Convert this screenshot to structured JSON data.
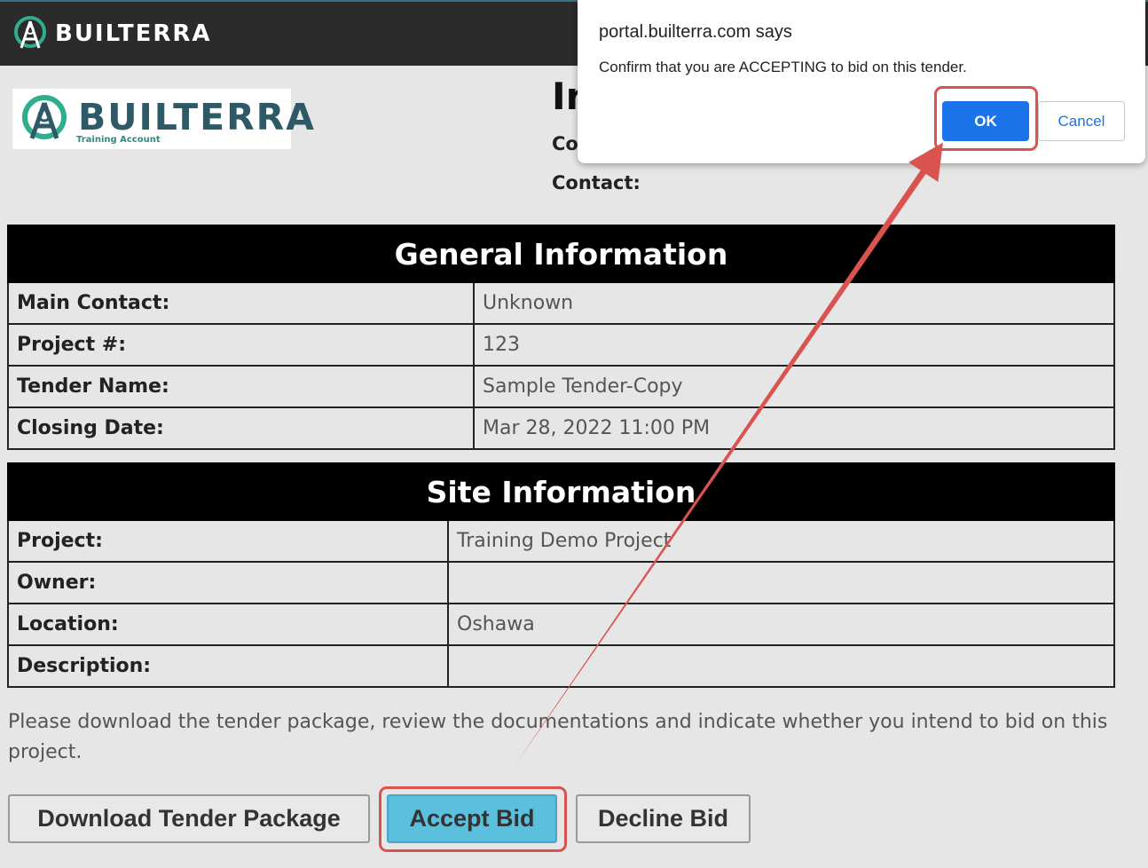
{
  "topbar": {
    "brand": "BUILTERRA"
  },
  "brand_logo": {
    "name": "BUILTERRA",
    "subtitle": "Training Account"
  },
  "header": {
    "title_partial": "Ir",
    "company_label_partial": "Co",
    "contact_label": "Contact:"
  },
  "general_info": {
    "heading": "General Information",
    "rows": [
      {
        "label": "Main Contact:",
        "value": "Unknown"
      },
      {
        "label": "Project #:",
        "value": "123"
      },
      {
        "label": "Tender Name:",
        "value": "Sample Tender-Copy"
      },
      {
        "label": "Closing Date:",
        "value": "Mar 28, 2022 11:00 PM"
      }
    ]
  },
  "site_info": {
    "heading": "Site Information",
    "rows": [
      {
        "label": "Project:",
        "value": "Training Demo Project"
      },
      {
        "label": "Owner:",
        "value": ""
      },
      {
        "label": "Location:",
        "value": "Oshawa"
      },
      {
        "label": "Description:",
        "value": ""
      }
    ]
  },
  "notice": "Please download the tender package, review the documentations and indicate whether you intend to bid on this project.",
  "buttons": {
    "download": "Download Tender Package",
    "accept": "Accept Bid",
    "decline": "Decline Bid"
  },
  "dialog": {
    "title": "portal.builterra.com says",
    "message": "Confirm that you are ACCEPTING to bid on this tender.",
    "ok": "OK",
    "cancel": "Cancel"
  },
  "colors": {
    "topbar": "#2b2b2b",
    "accent": "#5bc0de",
    "annotation": "#d9534f",
    "dialog_ok": "#1a73e8",
    "brand": "#2e5966"
  }
}
